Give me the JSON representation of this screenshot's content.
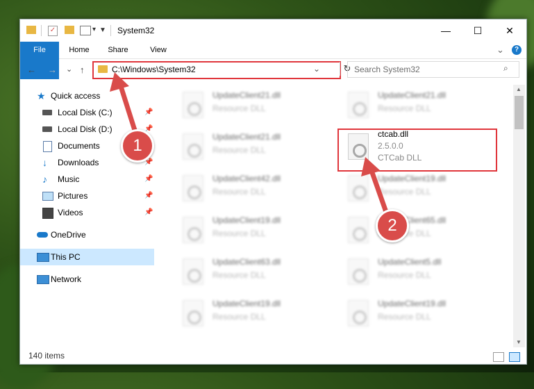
{
  "window": {
    "title": "System32"
  },
  "titlebar": {
    "minimize": "—",
    "maximize": "☐",
    "close": "✕"
  },
  "ribbon": {
    "tabs": [
      "File",
      "Home",
      "Share",
      "View"
    ],
    "expand": "⌄",
    "help": "?"
  },
  "nav": {
    "back": "←",
    "forward": "→",
    "recent": "⌄",
    "up": "↑",
    "address": "C:\\Windows\\System32",
    "address_dropdown": "⌄",
    "refresh": "↻",
    "search_placeholder": "Search System32",
    "search_icon": "⌕"
  },
  "sidebar": {
    "items": [
      {
        "label": "Quick access",
        "icon": "star-icon"
      },
      {
        "label": "Local Disk (C:)",
        "icon": "drive-icon",
        "pinned": true
      },
      {
        "label": "Local Disk (D:)",
        "icon": "drive-icon",
        "pinned": true
      },
      {
        "label": "Documents",
        "icon": "documents-icon",
        "pinned": true
      },
      {
        "label": "Downloads",
        "icon": "download-icon",
        "pinned": true
      },
      {
        "label": "Music",
        "icon": "music-icon",
        "pinned": true
      },
      {
        "label": "Pictures",
        "icon": "pictures-icon",
        "pinned": true
      },
      {
        "label": "Videos",
        "icon": "videos-icon",
        "pinned": true
      },
      {
        "label": "OneDrive",
        "icon": "cloud-icon"
      },
      {
        "label": "This PC",
        "icon": "computer-icon",
        "selected": true
      },
      {
        "label": "Network",
        "icon": "network-icon"
      }
    ],
    "pin_glyph": "📌"
  },
  "files": [
    {
      "name": "UpdateClient21.dll",
      "desc": "Resource DLL"
    },
    {
      "name": "UpdateClient21.dll",
      "desc": "Resource DLL"
    },
    {
      "name": "UpdateClient21.dll",
      "desc": "Resource DLL"
    },
    {
      "name": "ctcab.dll",
      "version": "2.5.0.0",
      "desc": "CTCab DLL"
    },
    {
      "name": "UpdateClient42.dll",
      "desc": "Resource DLL"
    },
    {
      "name": "UpdateClient19.dll",
      "desc": "Resource DLL"
    },
    {
      "name": "UpdateClient19.dll",
      "desc": "Resource DLL"
    },
    {
      "name": "UpdateClient65.dll",
      "desc": "Resource DLL"
    },
    {
      "name": "UpdateClient63.dll",
      "desc": "Resource DLL"
    },
    {
      "name": "UpdateClient5.dll",
      "desc": "Resource DLL"
    },
    {
      "name": "UpdateClient19.dll",
      "desc": "Resource DLL"
    },
    {
      "name": "UpdateClient19.dll",
      "desc": "Resource DLL"
    }
  ],
  "status": {
    "count": "140 items"
  },
  "annotations": {
    "badge1": "1",
    "badge2": "2",
    "accent": "#e0353b",
    "badge_color": "#d94c4a"
  }
}
